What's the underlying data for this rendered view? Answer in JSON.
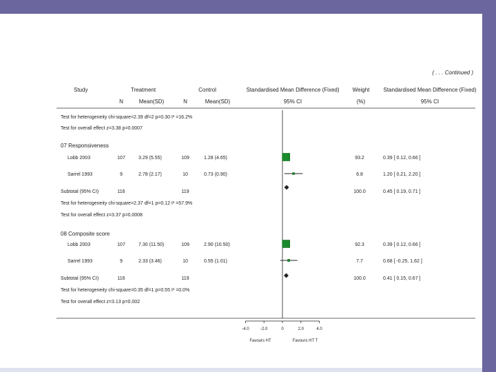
{
  "continued": "( . . . Continued )",
  "headers": {
    "study": "Study",
    "treatment": "Treatment",
    "control": "Control",
    "smd": "Standardised Mean Difference (Fixed)",
    "weight": "Weight",
    "smd2": "Standardised Mean Difference (Fixed)",
    "n1": "N",
    "mean1": "Mean(SD)",
    "n2": "N",
    "mean2": "Mean(SD)",
    "ci": "95% CI",
    "pct": "(%)",
    "ci2": "95% CI"
  },
  "text_rows": {
    "het_prev": "Test for heterogeneity chi-square=2.39 df=2 p=0.30 I² =16.2%",
    "overall_prev": "Test for overall effect z=3.38   p=0.0007",
    "group1": "07 Responsiveness",
    "sub1": "Subtotal (95% CI)",
    "sub1_n1": "116",
    "sub1_n2": "119",
    "sub1_w": "100.0",
    "sub1_ci": "0.45 [ 0.19, 0.71 ]",
    "het1": "Test for heterogeneity chi-square=2.37 df=1 p=0.12 I² =57.9%",
    "overall1": "Test for overall effect z=3.37   p=0.0008",
    "group2": "08 Composite score",
    "sub2": "Subtotal (95% CI)",
    "sub2_n1": "116",
    "sub2_n2": "119",
    "sub2_w": "100.0",
    "sub2_ci": "0.41 [ 0.15, 0.67 ]",
    "het2": "Test for heterogeneity chi-square=0.35 df=1 p=0.55 I² =0.0%",
    "overall2": "Test for overall effect z=3.13   p=0.002"
  },
  "axis": {
    "ticks": [
      "-4.0",
      "-2.0",
      "0",
      "2.0",
      "4.0"
    ],
    "favours_left": "Favours HT",
    "favours_right": "Favours HT T"
  },
  "colors": {
    "frame": "#6b679e",
    "box": "#1a8a2a",
    "line": "#222222"
  },
  "chart_data": {
    "type": "forest",
    "xlim": [
      -4,
      4
    ],
    "xticks": [
      -4,
      -2,
      0,
      2,
      4
    ],
    "studies": [
      {
        "group": "07 Responsiveness",
        "study": "Lobb 2003",
        "n1": "107",
        "mean1": "3.29 (5.55)",
        "n2": "109",
        "mean2": "1.28 (4.65)",
        "weight": "93.2",
        "ci_text": "0.39 [ 0.12, 0.66 ]",
        "smd": 0.39,
        "lo": 0.12,
        "hi": 0.66,
        "wt": 93.2
      },
      {
        "group": "07 Responsiveness",
        "study": "Sarrel 1993",
        "n1": "9",
        "mean1": "2.78 (2.17)",
        "n2": "10",
        "mean2": "0.73 (0.90)",
        "weight": "6.8",
        "ci_text": "1.20 [ 0.21, 2.20 ]",
        "smd": 1.2,
        "lo": 0.21,
        "hi": 2.2,
        "wt": 6.8
      },
      {
        "group": "08 Composite score",
        "study": "Lobb 2003",
        "n1": "107",
        "mean1": "7.30 (11.50)",
        "n2": "109",
        "mean2": "2.90 (10.50)",
        "weight": "92.3",
        "ci_text": "0.39 [ 0.12, 0.66 ]",
        "smd": 0.39,
        "lo": 0.12,
        "hi": 0.66,
        "wt": 92.3
      },
      {
        "group": "08 Composite score",
        "study": "Sarrel 1993",
        "n1": "9",
        "mean1": "2.33 (3.46)",
        "n2": "10",
        "mean2": "0.55 (1.01)",
        "weight": "7.7",
        "ci_text": "0.68 [ -0.25, 1.62 ]",
        "smd": 0.68,
        "lo": -0.25,
        "hi": 1.62,
        "wt": 7.7
      }
    ],
    "subtotals": [
      {
        "group": "07 Responsiveness",
        "smd": 0.45,
        "lo": 0.19,
        "hi": 0.71
      },
      {
        "group": "08 Composite score",
        "smd": 0.41,
        "lo": 0.15,
        "hi": 0.67
      }
    ]
  }
}
